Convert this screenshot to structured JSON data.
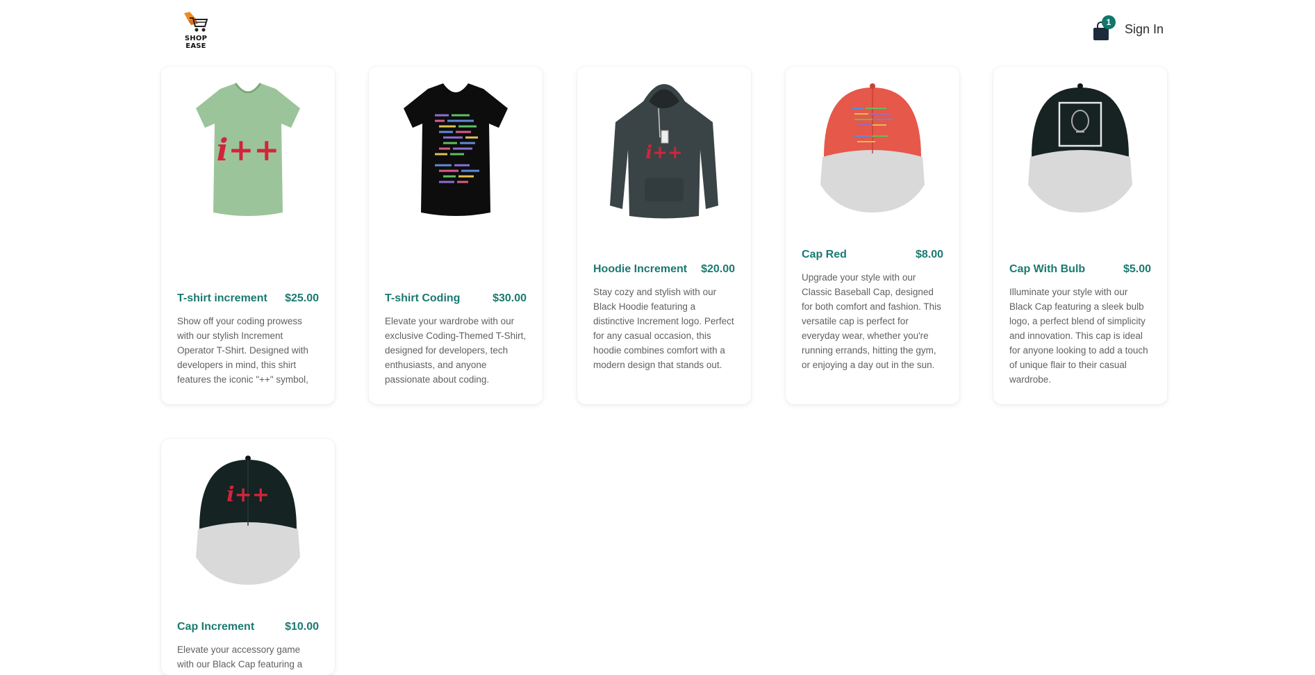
{
  "header": {
    "logo_text": "SHOP EASE",
    "cart_count": "1",
    "signin_label": "Sign In"
  },
  "colors": {
    "accent": "#11776b",
    "title": "#1a7a70"
  },
  "products": [
    {
      "name": "T-shirt increment",
      "price": "$25.00",
      "description": "Show off your coding prowess with our stylish Increment Operator T-Shirt. Designed with developers in mind, this shirt features the iconic \"++\" symbol,",
      "image": "green-tshirt-icon"
    },
    {
      "name": "T-shirt Coding",
      "price": "$30.00",
      "description": "Elevate your wardrobe with our exclusive Coding-Themed T-Shirt, designed for developers, tech enthusiasts, and anyone passionate about coding.",
      "image": "black-tshirt-icon"
    },
    {
      "name": "Hoodie Increment",
      "price": "$20.00",
      "description": "Stay cozy and stylish with our Black Hoodie featuring a distinctive Increment logo. Perfect for any casual occasion, this hoodie combines comfort with a modern design that stands out.",
      "image": "hoodie-icon"
    },
    {
      "name": "Cap Red",
      "price": "$8.00",
      "description": "Upgrade your style with our Classic Baseball Cap, designed for both comfort and fashion. This versatile cap is perfect for everyday wear, whether you're running errands, hitting the gym, or enjoying a day out in the sun.",
      "image": "red-cap-icon"
    },
    {
      "name": "Cap With Bulb",
      "price": "$5.00",
      "description": "Illuminate your style with our Black Cap featuring a sleek bulb logo, a perfect blend of simplicity and innovation. This cap is ideal for anyone looking to add a touch of unique flair to their casual wardrobe.",
      "image": "bulb-cap-icon"
    },
    {
      "name": "Cap Increment",
      "price": "$10.00",
      "description": "Elevate your accessory game with our Black Cap featuring a",
      "image": "increment-cap-icon"
    }
  ]
}
